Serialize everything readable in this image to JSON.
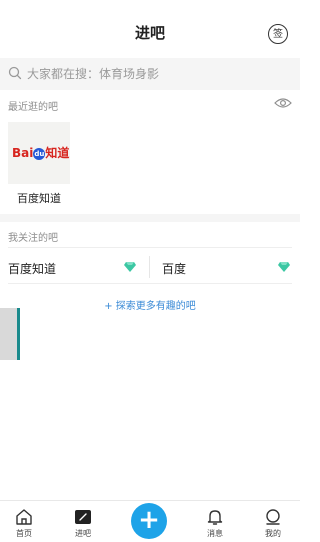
{
  "header": {
    "title": "进吧",
    "sign_label": "签"
  },
  "search": {
    "placeholder": "大家都在搜：体育场身影"
  },
  "recent": {
    "label": "最近逛的吧",
    "items": [
      {
        "name": "百度知道",
        "logo_text": "Bai",
        "logo_paw": "du",
        "logo_suffix": "知道"
      }
    ]
  },
  "followed": {
    "label": "我关注的吧",
    "items": [
      {
        "name": "百度知道"
      },
      {
        "name": "百度"
      }
    ],
    "explore_label": "+ 探索更多有趣的吧"
  },
  "nav": {
    "items": [
      {
        "label": "首页",
        "icon": "home-icon"
      },
      {
        "label": "进吧",
        "icon": "forum-icon"
      },
      {
        "label": "",
        "icon": "plus-icon"
      },
      {
        "label": "消息",
        "icon": "bell-icon"
      },
      {
        "label": "我的",
        "icon": "profile-icon"
      }
    ]
  },
  "colors": {
    "accent": "#1ea3e8",
    "link": "#3a8ad6",
    "gem": "#3cc7a3",
    "logo_red": "#d7251f",
    "logo_blue": "#2458d6"
  }
}
